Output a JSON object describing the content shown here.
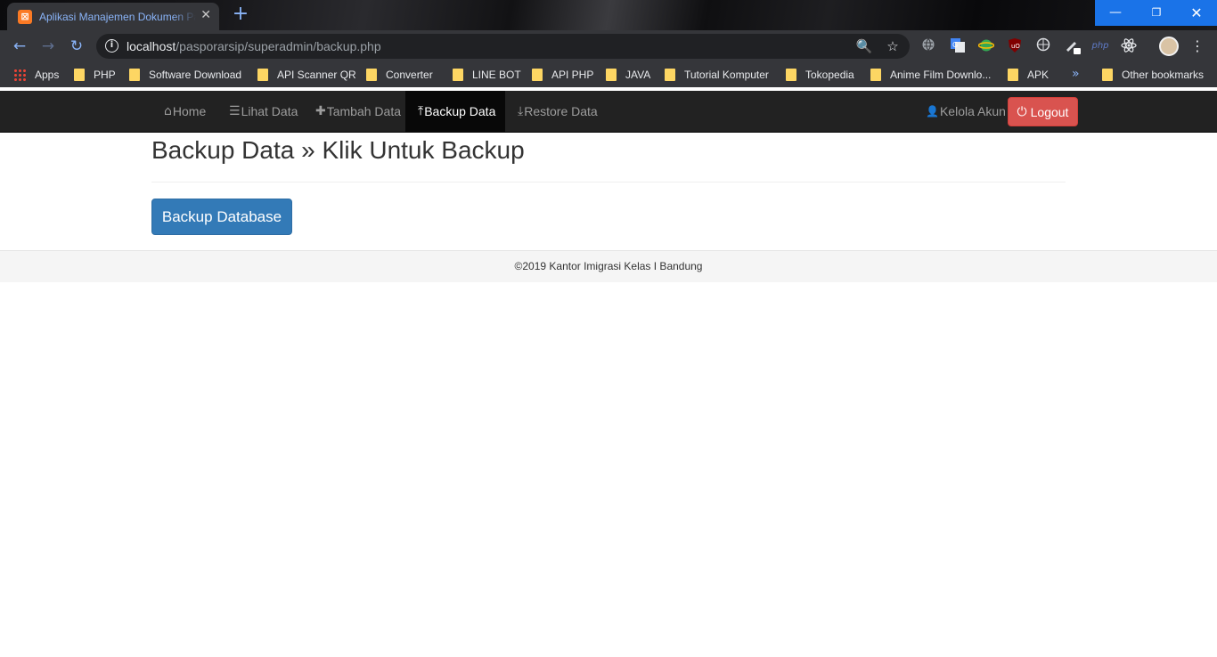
{
  "browser": {
    "tab": {
      "favicon_glyph": "⊠",
      "title": "Aplikasi Manajemen Dokumen Paspor",
      "close_glyph": "✕"
    },
    "new_tab_glyph": "+",
    "window_controls": {
      "minimize": "—",
      "maximize": "❐",
      "close": "✕"
    },
    "nav": {
      "back": "←",
      "forward": "→",
      "reload": "↻"
    },
    "address": {
      "info_glyph": "i",
      "host": "localhost",
      "path": "/pasporarsip/superadmin/backup.php"
    },
    "omnibox_icons": {
      "zoom": "🔍",
      "star": "☆"
    },
    "extensions": [
      "globe-icon",
      "translate-icon",
      "green-globe-icon",
      "ublock-icon",
      "world-icon",
      "pen-icon",
      "php-icon",
      "react-icon"
    ],
    "menu_glyph": "⋮",
    "bookmarks": {
      "apps_label": "Apps",
      "items": [
        "PHP",
        "Software Download",
        "API Scanner QR",
        "Converter",
        "LINE BOT",
        "API PHP",
        "JAVA",
        "Tutorial Komputer",
        "Tokopedia",
        "Anime Film Downlo...",
        "APK"
      ],
      "more_glyph": "»",
      "other_label": "Other bookmarks"
    }
  },
  "navbar": {
    "items": [
      {
        "icon": "home-icon",
        "glyph": "⌂",
        "label": "Home",
        "active": false
      },
      {
        "icon": "list-icon",
        "glyph": "☰",
        "label": "Lihat Data",
        "active": false
      },
      {
        "icon": "plus-icon",
        "glyph": "✚",
        "label": "Tambah Data",
        "active": false
      },
      {
        "icon": "export-icon",
        "glyph": "⤒",
        "label": "Backup Data",
        "active": true
      },
      {
        "icon": "import-icon",
        "glyph": "⤓",
        "label": "Restore Data",
        "active": false
      }
    ],
    "account": {
      "glyph": "👤",
      "label": "Kelola Akun"
    },
    "logout": {
      "glyph": "⏻",
      "label": "Logout"
    }
  },
  "main": {
    "title": "Backup Data » Klik Untuk Backup",
    "button_label": "Backup Database"
  },
  "footer": {
    "text": "©2019 Kantor Imigrasi Kelas I Bandung"
  },
  "colors": {
    "navbar_bg": "#222222",
    "primary": "#337ab7",
    "danger": "#d9534f",
    "chrome_accent": "#1a73e8"
  }
}
